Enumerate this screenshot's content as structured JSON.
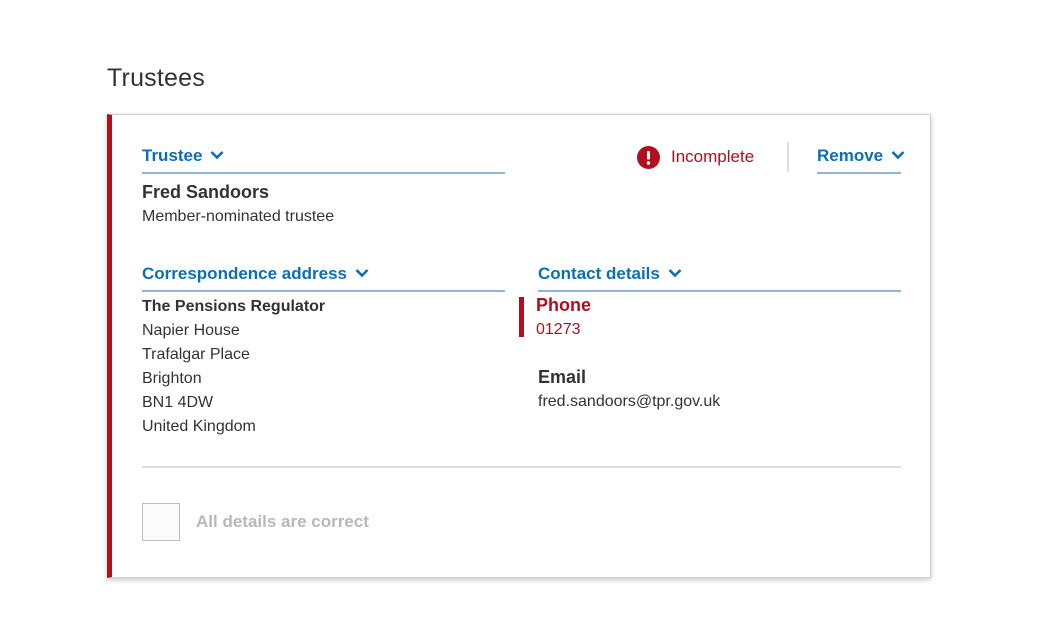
{
  "page": {
    "title": "Trustees"
  },
  "card": {
    "trustee_section": {
      "label": "Trustee",
      "name": "Fred Sandoors",
      "role": "Member-nominated trustee"
    },
    "status": {
      "label": "Incomplete",
      "icon": "alert-circle-icon",
      "color": "#b10e1e"
    },
    "remove": {
      "label": "Remove"
    },
    "address_section": {
      "label": "Correspondence address",
      "lines": [
        "The Pensions Regulator",
        "Napier House",
        "Trafalgar Place",
        "Brighton",
        "BN1 4DW",
        "United Kingdom"
      ]
    },
    "contact_section": {
      "label": "Contact details",
      "phone_label": "Phone",
      "phone_value": "01273",
      "email_label": "Email",
      "email_value": "fred.sandoors@tpr.gov.uk"
    },
    "confirm": {
      "label": "All details are correct",
      "checked": false
    }
  },
  "colors": {
    "accent_link": "#0b6fb8",
    "error": "#b10e1e",
    "text": "#333333"
  }
}
